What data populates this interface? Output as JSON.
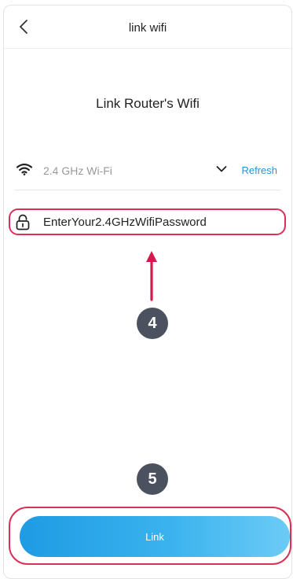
{
  "header": {
    "title": "link wifi"
  },
  "main": {
    "heading": "Link Router's Wifi",
    "wifi": {
      "network_name": "2.4 GHz Wi-Fi",
      "refresh_label": "Refresh"
    },
    "password": {
      "value": "EnterYour2.4GHzWifiPassword"
    },
    "steps": {
      "four": "4",
      "five": "5"
    },
    "link_button_label": "Link"
  },
  "colors": {
    "accent": "#2196d9",
    "highlight": "#d93157",
    "badge": "#4c5160"
  }
}
